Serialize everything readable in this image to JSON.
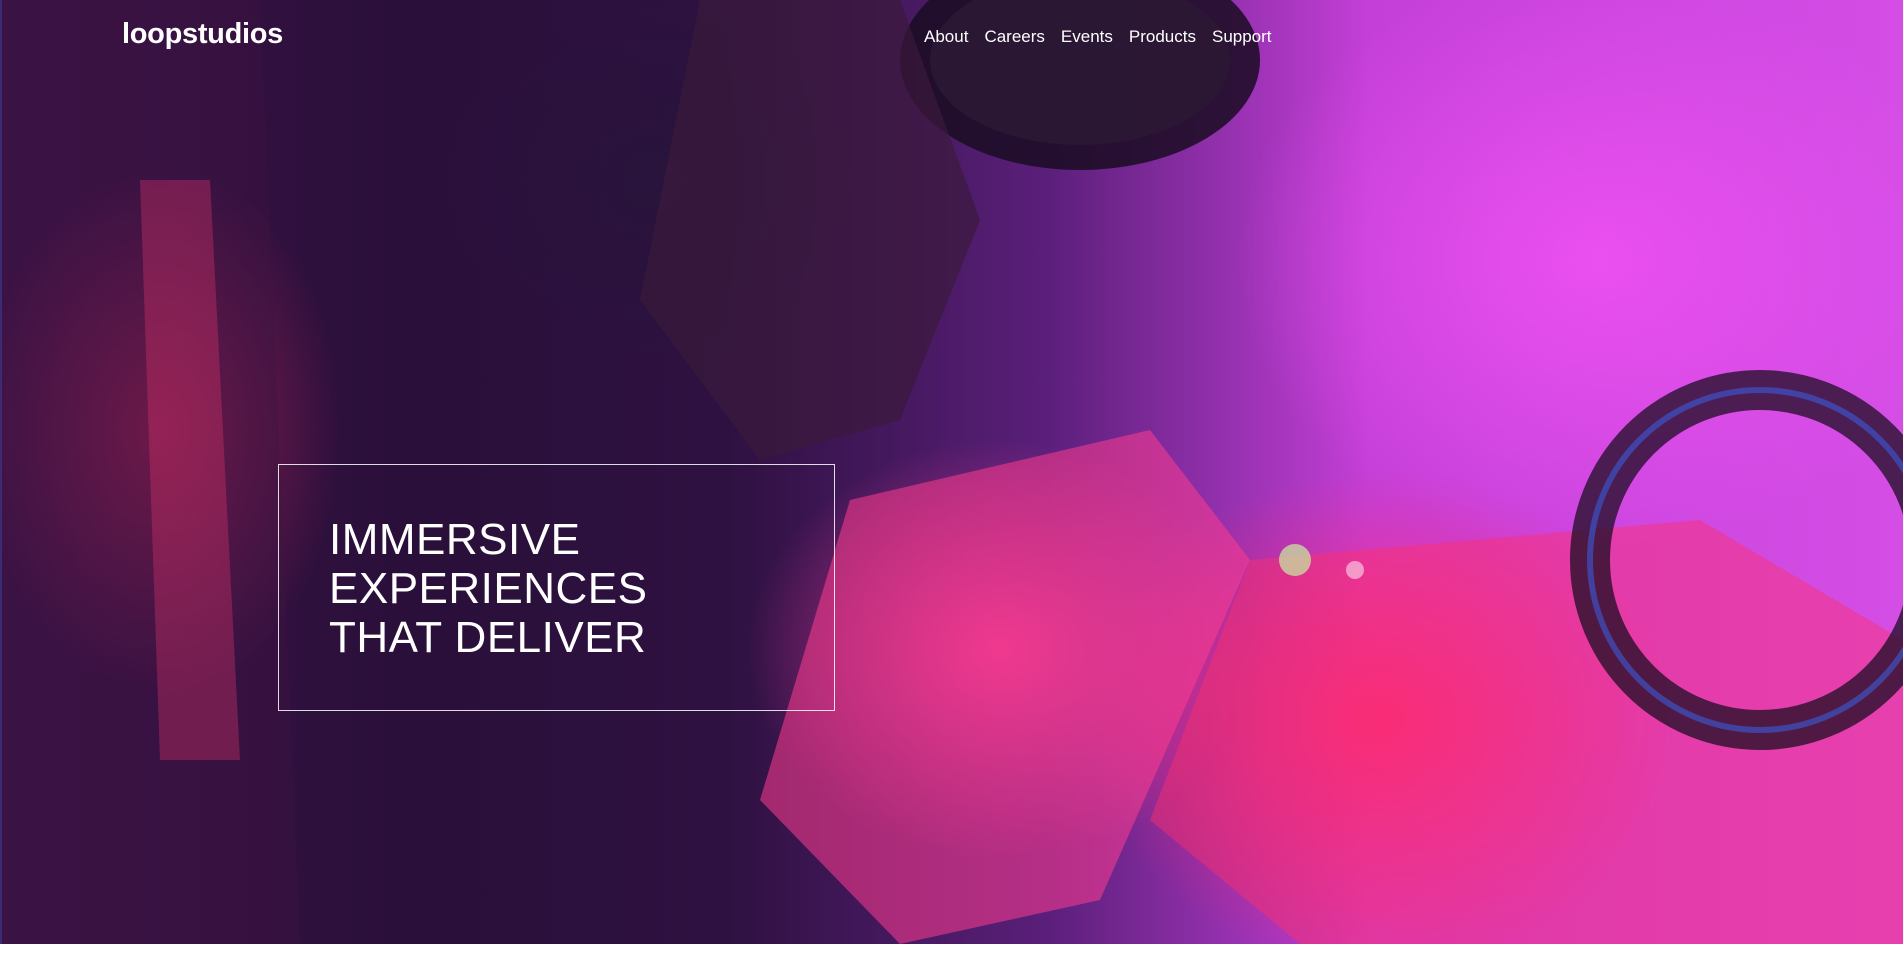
{
  "header": {
    "logo": "loopstudios",
    "nav": [
      "About",
      "Careers",
      "Events",
      "Products",
      "Support"
    ]
  },
  "hero": {
    "headline_lines": [
      "IMMERSIVE",
      "EXPERIENCES",
      "THAT DELIVER"
    ],
    "background_colors": {
      "magenta": "#d44ee6",
      "deep_purple": "#2a0f3a",
      "hot_pink": "#ff2870"
    }
  }
}
